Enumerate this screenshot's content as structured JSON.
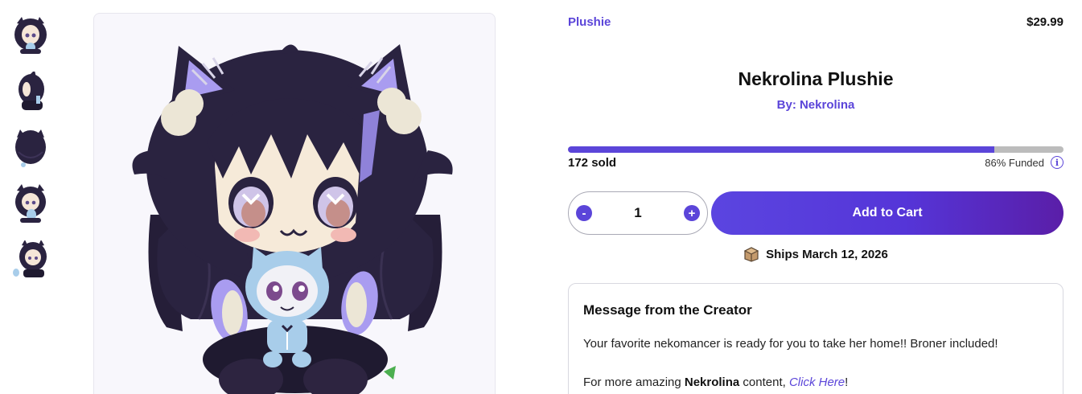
{
  "product": {
    "category": "Plushie",
    "price": "$29.99",
    "title": "Nekrolina Plushie",
    "creator_line": "By: Nekrolina",
    "progress_fraction": 0.86,
    "sold_text": "172 sold",
    "funded_text": "86% Funded",
    "info_symbol": "i"
  },
  "quantity": {
    "minus_label": "-",
    "value": "1",
    "plus_label": "+"
  },
  "cart": {
    "add_label": "Add to Cart"
  },
  "shipping": {
    "icon": "package-icon",
    "text": "Ships March 12, 2026"
  },
  "message": {
    "title": "Message from the Creator",
    "body": "Your favorite nekomancer is ready for you to take her home!! Broner included!",
    "more_prefix": "For more amazing ",
    "more_name": "Nekrolina",
    "more_middle": " content, ",
    "more_link": "Click Here",
    "more_suffix": "!"
  },
  "colors": {
    "accent": "#5b45d9",
    "progress_track": "#bcbcbc",
    "plush_dark": "#2a2340",
    "plush_lavender": "#a99cf0",
    "plush_light_blue": "#a8cdea"
  },
  "thumbnails": [
    "plushie-front-thumb",
    "plushie-side-thumb",
    "plushie-back-thumb",
    "plushie-angle-thumb",
    "plushie-with-broner-thumb"
  ]
}
